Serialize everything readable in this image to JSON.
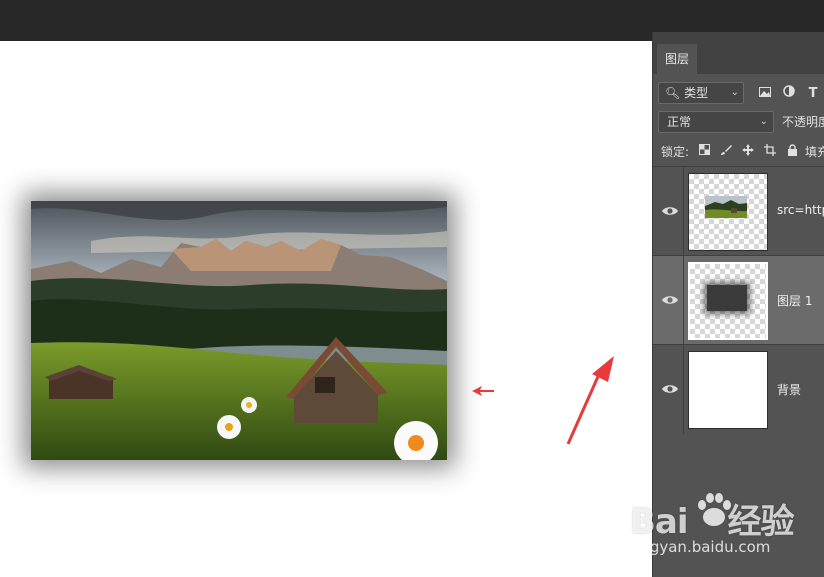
{
  "panel": {
    "tab_label": "图层",
    "filter": {
      "label": "类型",
      "icon": "search-icon"
    },
    "filter_icons": [
      "image-filter-icon",
      "adjustment-filter-icon",
      "type-filter-icon"
    ],
    "filter_type_glyph": "T",
    "blend_mode": "正常",
    "opacity_label": "不透明度",
    "lock_label": "锁定:",
    "fill_label": "填充",
    "layers": [
      {
        "name": "src=http...",
        "visible": true,
        "selected": false,
        "kind": "smart-object"
      },
      {
        "name": "图层 1",
        "visible": true,
        "selected": true,
        "kind": "pixel"
      },
      {
        "name": "背景",
        "visible": true,
        "selected": false,
        "kind": "background"
      }
    ]
  },
  "watermark": {
    "brand": "Bai",
    "brand_suffix": "经验",
    "url": "jingyan.baidu.com"
  },
  "colors": {
    "annotation_arrow": "#e83a3a",
    "panel_bg": "#535353",
    "selected_layer": "#6b6b6b"
  }
}
